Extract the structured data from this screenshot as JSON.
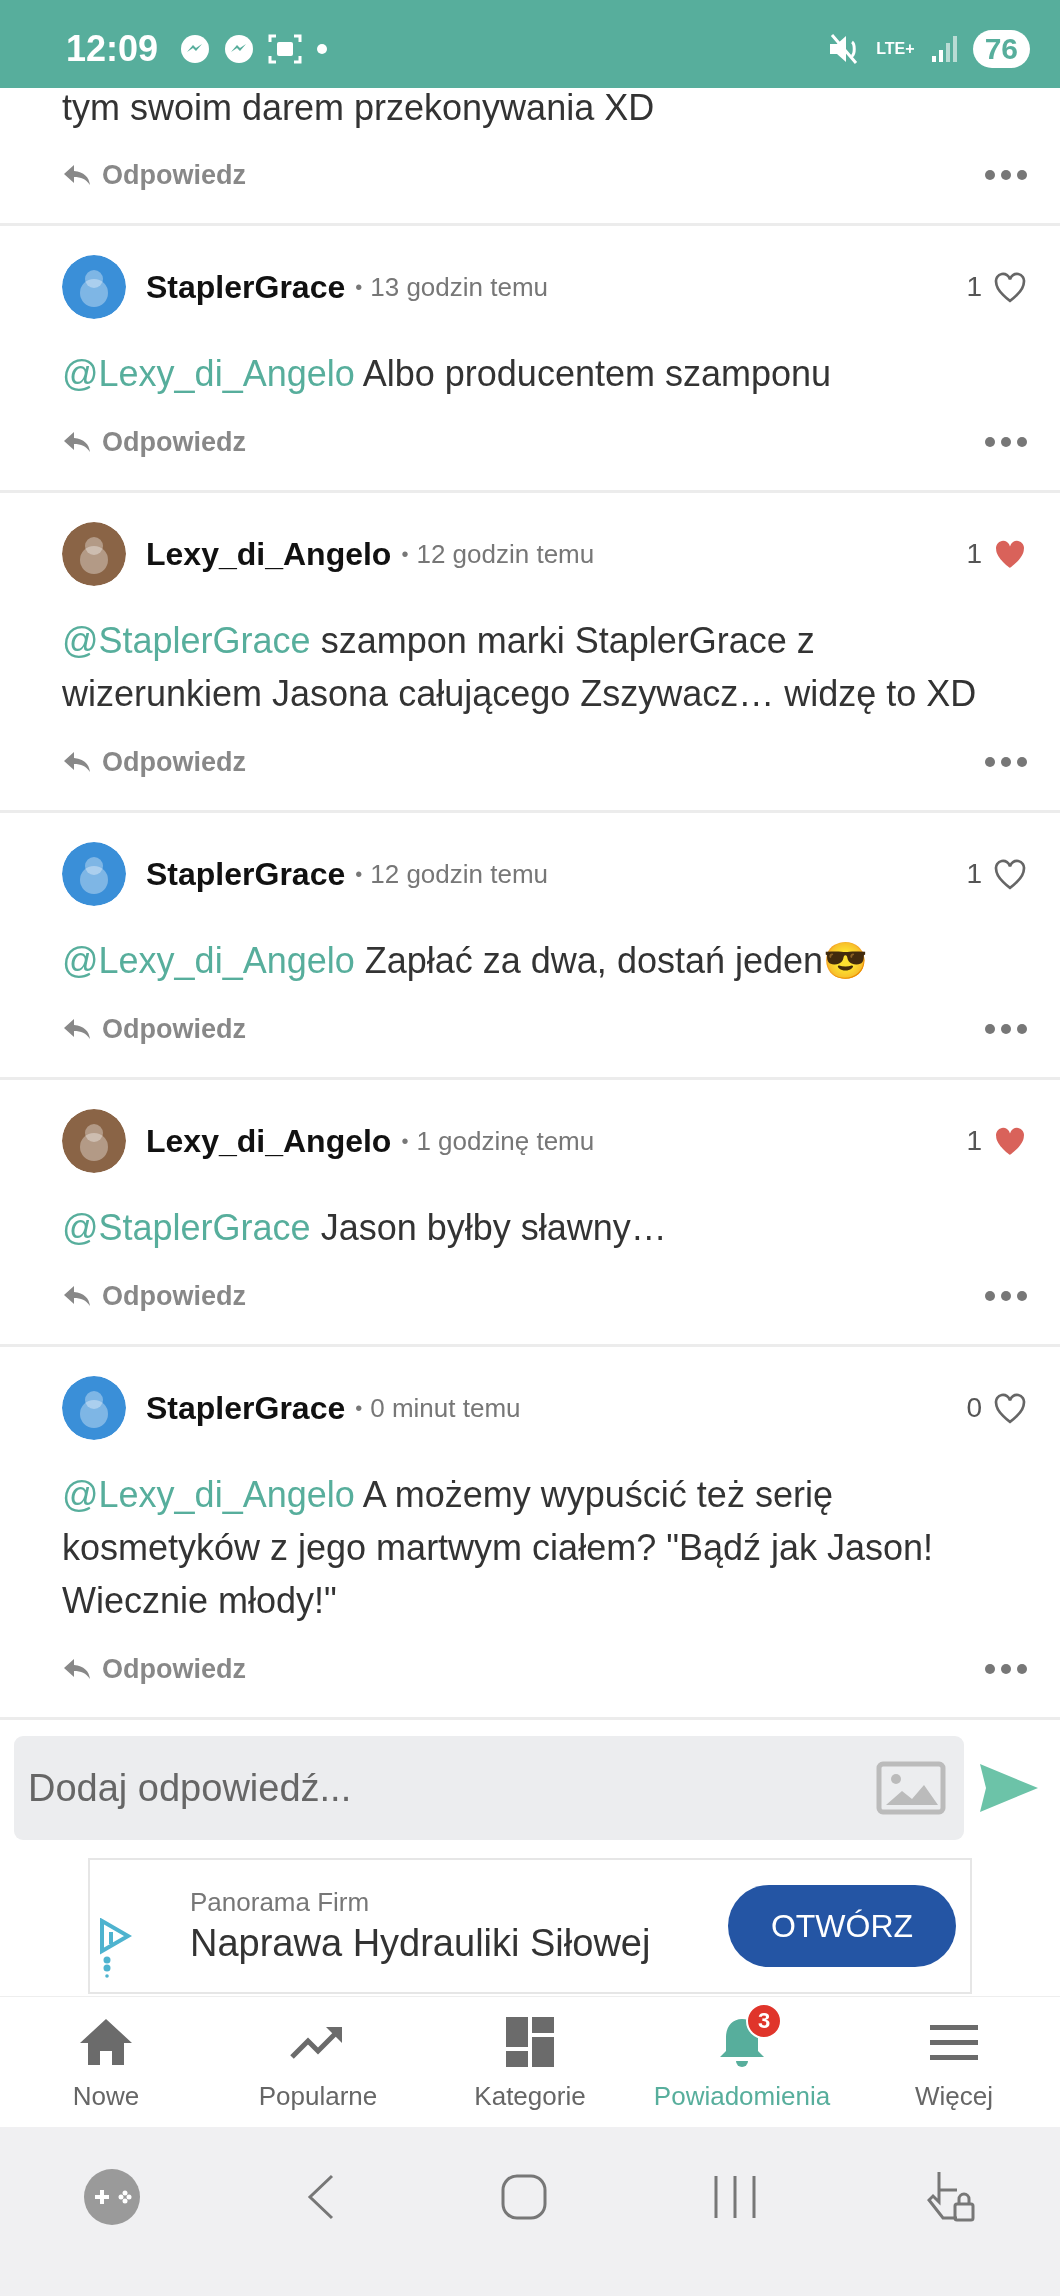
{
  "status_bar": {
    "time": "12:09",
    "network": "LTE+",
    "battery": "76"
  },
  "partial_comment": {
    "text": "tym swoim darem przekonywania XD",
    "reply_label": "Odpowiedz"
  },
  "comments": [
    {
      "author": "StaplerGrace",
      "color": "#3a8fd8",
      "separator": "•",
      "time": "13 godzin temu",
      "likes": "1",
      "liked": false,
      "mention": "@Lexy_di_Angelo",
      "text": "Albo producentem szamponu",
      "reply_label": "Odpowiedz"
    },
    {
      "author": "Lexy_di_Angelo",
      "color": "#8a6446",
      "separator": "•",
      "time": "12 godzin temu",
      "likes": "1",
      "liked": true,
      "mention": "@StaplerGrace",
      "text": "szampon marki StaplerGrace z wizerunkiem Jasona całującego Zszywacz… widzę to XD",
      "reply_label": "Odpowiedz"
    },
    {
      "author": "StaplerGrace",
      "color": "#3a8fd8",
      "separator": "•",
      "time": "12 godzin temu",
      "likes": "1",
      "liked": false,
      "mention": "@Lexy_di_Angelo",
      "text": "Zapłać za dwa, dostań jeden😎",
      "reply_label": "Odpowiedz"
    },
    {
      "author": "Lexy_di_Angelo",
      "color": "#8a6446",
      "separator": "•",
      "time": "1 godzinę temu",
      "likes": "1",
      "liked": true,
      "mention": "@StaplerGrace",
      "text": "Jason byłby sławny…",
      "reply_label": "Odpowiedz"
    },
    {
      "author": "StaplerGrace",
      "color": "#3a8fd8",
      "separator": "•",
      "time": "0 minut temu",
      "likes": "0",
      "liked": false,
      "mention": "@Lexy_di_Angelo",
      "text": "A możemy wypuścić też serię kosmetyków z jego martwym ciałem? \"Bądź jak Jason! Wiecznie młody!\"",
      "reply_label": "Odpowiedz"
    }
  ],
  "reply_box": {
    "placeholder": "Dodaj odpowiedź..."
  },
  "ad": {
    "advertiser": "Panorama Firm",
    "headline": "Naprawa Hydrauliki Siłowej",
    "button": "OTWÓRZ"
  },
  "nav_tabs": [
    {
      "kind": "home",
      "label": "Nowe",
      "selected": false
    },
    {
      "kind": "trending",
      "label": "Popularne",
      "selected": false
    },
    {
      "kind": "grid",
      "label": "Kategorie",
      "selected": false
    },
    {
      "kind": "bell",
      "label": "Powiadomienia",
      "selected": true,
      "badge": "3"
    },
    {
      "kind": "menu",
      "label": "Więcej",
      "selected": false
    }
  ]
}
